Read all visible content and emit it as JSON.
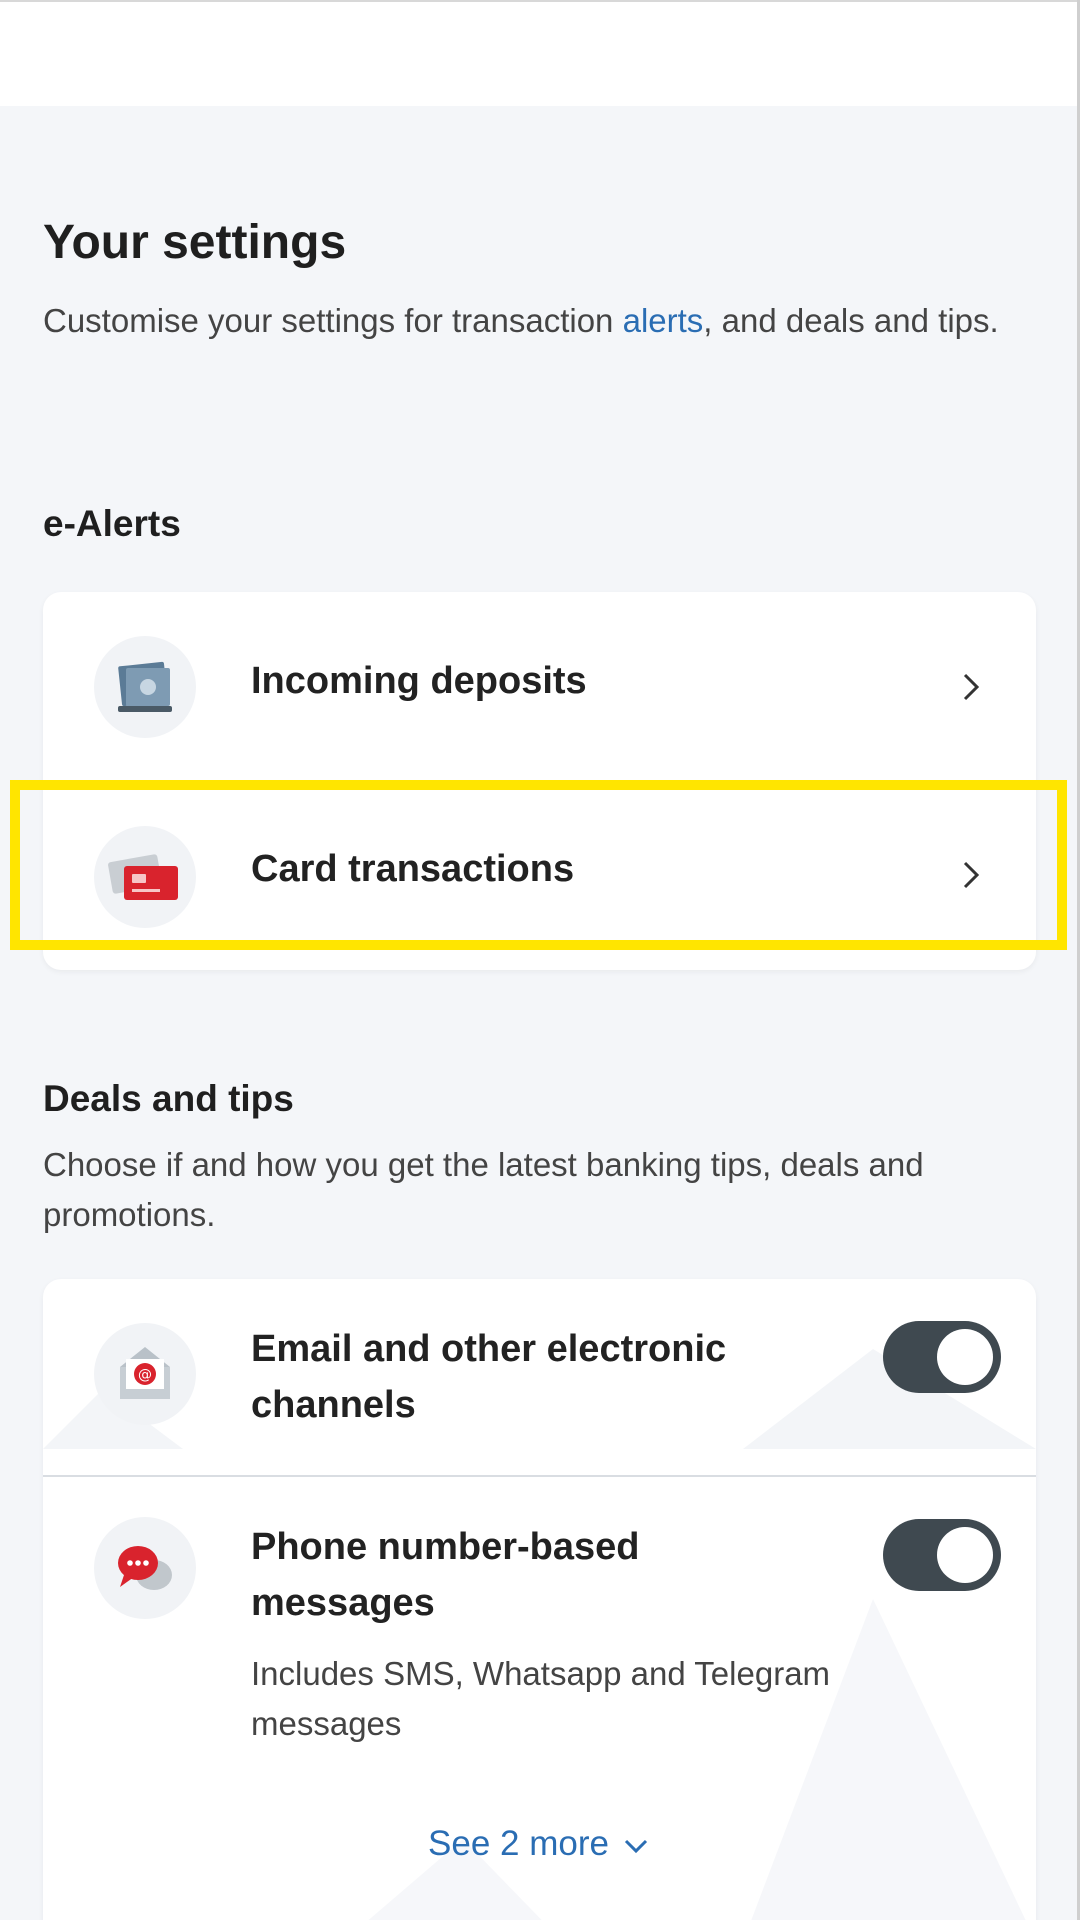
{
  "settings": {
    "title": "Your settings",
    "subtitle_before": "Customise your settings for transaction ",
    "subtitle_link": "alerts",
    "subtitle_after": ", and deals and tips."
  },
  "ealerts": {
    "heading": "e-Alerts",
    "items": [
      {
        "label": "Incoming deposits",
        "icon": "deposit-icon"
      },
      {
        "label": "Card transactions",
        "icon": "card-icon"
      }
    ]
  },
  "deals": {
    "heading": "Deals and tips",
    "description": "Choose if and how you get the latest banking tips, deals and promotions.",
    "items": [
      {
        "label": "Email and other electronic channels",
        "icon": "email-icon",
        "enabled": true
      },
      {
        "label": "Phone number-based messages",
        "sublabel": "Includes SMS, Whatsapp and Telegram messages",
        "icon": "chat-icon",
        "enabled": true
      }
    ],
    "see_more": "See 2 more"
  },
  "colors": {
    "accent": "#2a6db3",
    "toggle_on": "#3f4950",
    "brand_red": "#d9232d",
    "highlight": "#ffe500",
    "background": "#f4f6f9"
  }
}
